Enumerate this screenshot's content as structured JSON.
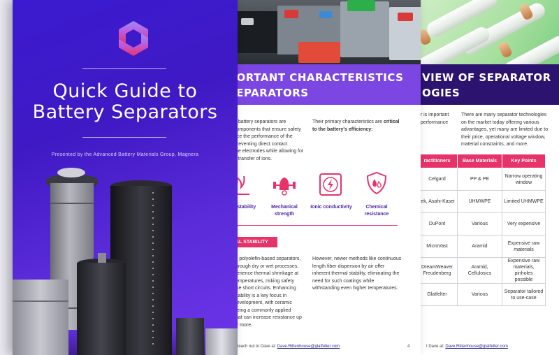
{
  "cover": {
    "title_line1": "Quick Guide to",
    "title_line2": "Battery Separators",
    "subtitle": "Presented by the Advanced Battery Materials Group, Magnera",
    "colors": {
      "background": "#3b1bd0",
      "logo_top": "#9a8cff",
      "logo_bottom": "#e8336a"
    }
  },
  "page2": {
    "heading_line1": "PORTANT CHARACTERISTICS",
    "heading_line2": "SEPARATORS",
    "intro_left": [
      "n battery separators are",
      "components that ensure safety",
      "nce the performance of the",
      "preventing direct contact",
      "the electrodes while allowing for",
      "h transfer of ions."
    ],
    "intro_right_plain": "Their primary characteristics are",
    "intro_right_bold_1": "critical",
    "intro_right_bold_2": "to the battery's efficiency:",
    "characteristics": [
      {
        "icon": "flame-icon",
        "label_line1": "al stability",
        "label_line2": ""
      },
      {
        "icon": "muscle-arm-icon",
        "label_line1": "Mechanical",
        "label_line2": "strength"
      },
      {
        "icon": "lightning-icon",
        "label_line1": "Ionic conductivity",
        "label_line2": ""
      },
      {
        "icon": "shield-drop-icon",
        "label_line1": "Chemical",
        "label_line2": "resistance"
      }
    ],
    "section_label": "AL STABILITY",
    "body_left": [
      "al polyolefin-based separators,",
      "through dry or wet processes,",
      "perience thermal shrinkage at",
      "temperatures, risking safety",
      "like short circuits. Enhancing",
      "stability is a key focus in",
      "development, with ceramic",
      "being a commonly applied",
      "that can increase resistance up",
      "or more."
    ],
    "body_right": [
      "However, newer methods like continuous",
      "length fiber dispersion by air offer",
      "inherent thermal stability, eliminating the",
      "need for such coatings while",
      "withstanding even higher temperatures."
    ],
    "footer_text": "Reach out to Dave at:",
    "footer_email": "Dave.Rittenhouse@glatfelter.com",
    "page_number": "4",
    "colors": {
      "band": "#7c46e2",
      "accent": "#e8336a",
      "icon_label": "#4a1fa0"
    }
  },
  "page3": {
    "heading_line1": "VIEW OF SEPARATOR",
    "heading_line2": "OGIES",
    "intro_left": [
      "tor is important",
      "d performance"
    ],
    "intro_right": [
      "There are many separator technologies",
      "on the market today offering various",
      "advantages, yet many are limited due to",
      "their price, operational voltage window,",
      "material constraints, and more."
    ],
    "table": {
      "headers": [
        "ractitioners",
        "Base Materials",
        "Key Points"
      ],
      "rows": [
        {
          "practitioners": [
            "Celgard"
          ],
          "materials": [
            "PP & PE"
          ],
          "points": [
            "Narrow operating",
            "window"
          ]
        },
        {
          "practitioners": [
            "tek, Asahi-Kasei"
          ],
          "materials": [
            "UHMWPE"
          ],
          "points": [
            "Limited UHMWPE"
          ]
        },
        {
          "practitioners": [
            "DuPont"
          ],
          "materials": [
            "Various"
          ],
          "points": [
            "Very expensive"
          ]
        },
        {
          "practitioners": [
            "MicroVast"
          ],
          "materials": [
            "Aramid"
          ],
          "points": [
            "Expensive raw",
            "materials"
          ]
        },
        {
          "practitioners": [
            "DreamWeaver",
            "Freudenberg"
          ],
          "materials": [
            "Aramid, Cellulosics"
          ],
          "points": [
            "Expensive raw",
            "materials, pinholes",
            "possible"
          ]
        },
        {
          "practitioners": [
            "Glatfelter"
          ],
          "materials": [
            "Various"
          ],
          "points": [
            "Separator tailored",
            "to use-case"
          ]
        }
      ]
    },
    "footer_text": "t Dave at:",
    "footer_email": "Dave.Rittenhouse@glatfelter.com",
    "colors": {
      "band": "#2c1370",
      "table_header": "#e8336a"
    }
  }
}
